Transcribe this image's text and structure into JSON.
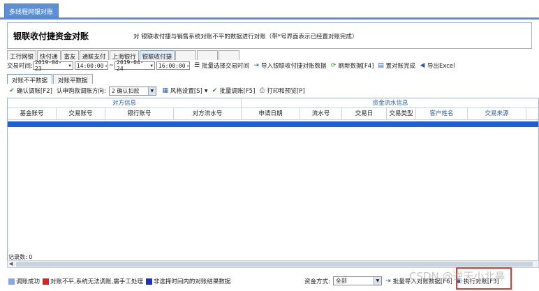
{
  "window_tab": "多线程网银对账",
  "header": {
    "title": "银联收付捷资金对账",
    "description": "对 银联收付捷与销售系统对账不平的数据进行对账（带*号界面表示已经置对账完成）"
  },
  "bank_tabs": [
    "工行网银",
    "快付通",
    "富友",
    "通联支付",
    "上海银行",
    "银联收付捷",
    "",
    "",
    ""
  ],
  "toolbar1": {
    "date_label": "交易时间:",
    "start_date": "2019-04-23",
    "start_time": "14:00:00",
    "tilde": "~",
    "end_date": "2019-04-24",
    "end_time": "16:00:00",
    "batch_select_time": "批量选择交易时间",
    "import_data": "导入银联收付捷对账数据",
    "refresh_data": "刷新数据[F4]",
    "set_complete": "置对账完成",
    "export_excel": "导出Excel"
  },
  "view_tabs": [
    "对账不平数据",
    "对账平数据"
  ],
  "toolbar2": {
    "confirm_adjust": "确认调账[F2]",
    "direction_label": "认申购款调账方向:",
    "direction_value": "2  确认扣款",
    "style_settings": "风格设置[S]",
    "batch_adjust": "批量调账[F5]",
    "print_preview": "打印和预览[P]"
  },
  "grid": {
    "group_left": "对方信息",
    "group_right": "资金流水信息",
    "columns": [
      "基金账号",
      "交易账号",
      "银行账号",
      "对方流水号",
      "申请日期",
      "流水号",
      "交易日",
      "交易类型",
      "客户姓名",
      "交易来源"
    ]
  },
  "record_count": "记录数: 0",
  "legend": [
    {
      "label": "调账成功",
      "color": "#8aa6e8"
    },
    {
      "label": "对账不平,系统无法调账,需手工处理",
      "color": "#e02020"
    },
    {
      "label": "非选择时间内的对账结果数据",
      "color": "#1a2fcf"
    }
  ],
  "bottom": {
    "fund_mode_label": "资金方式:",
    "fund_mode_value": "全部",
    "batch_import": "批量导入对账数据[F6]",
    "execute": "执行对账[F3]"
  },
  "watermark": "CSDN @逆天小北鼻"
}
